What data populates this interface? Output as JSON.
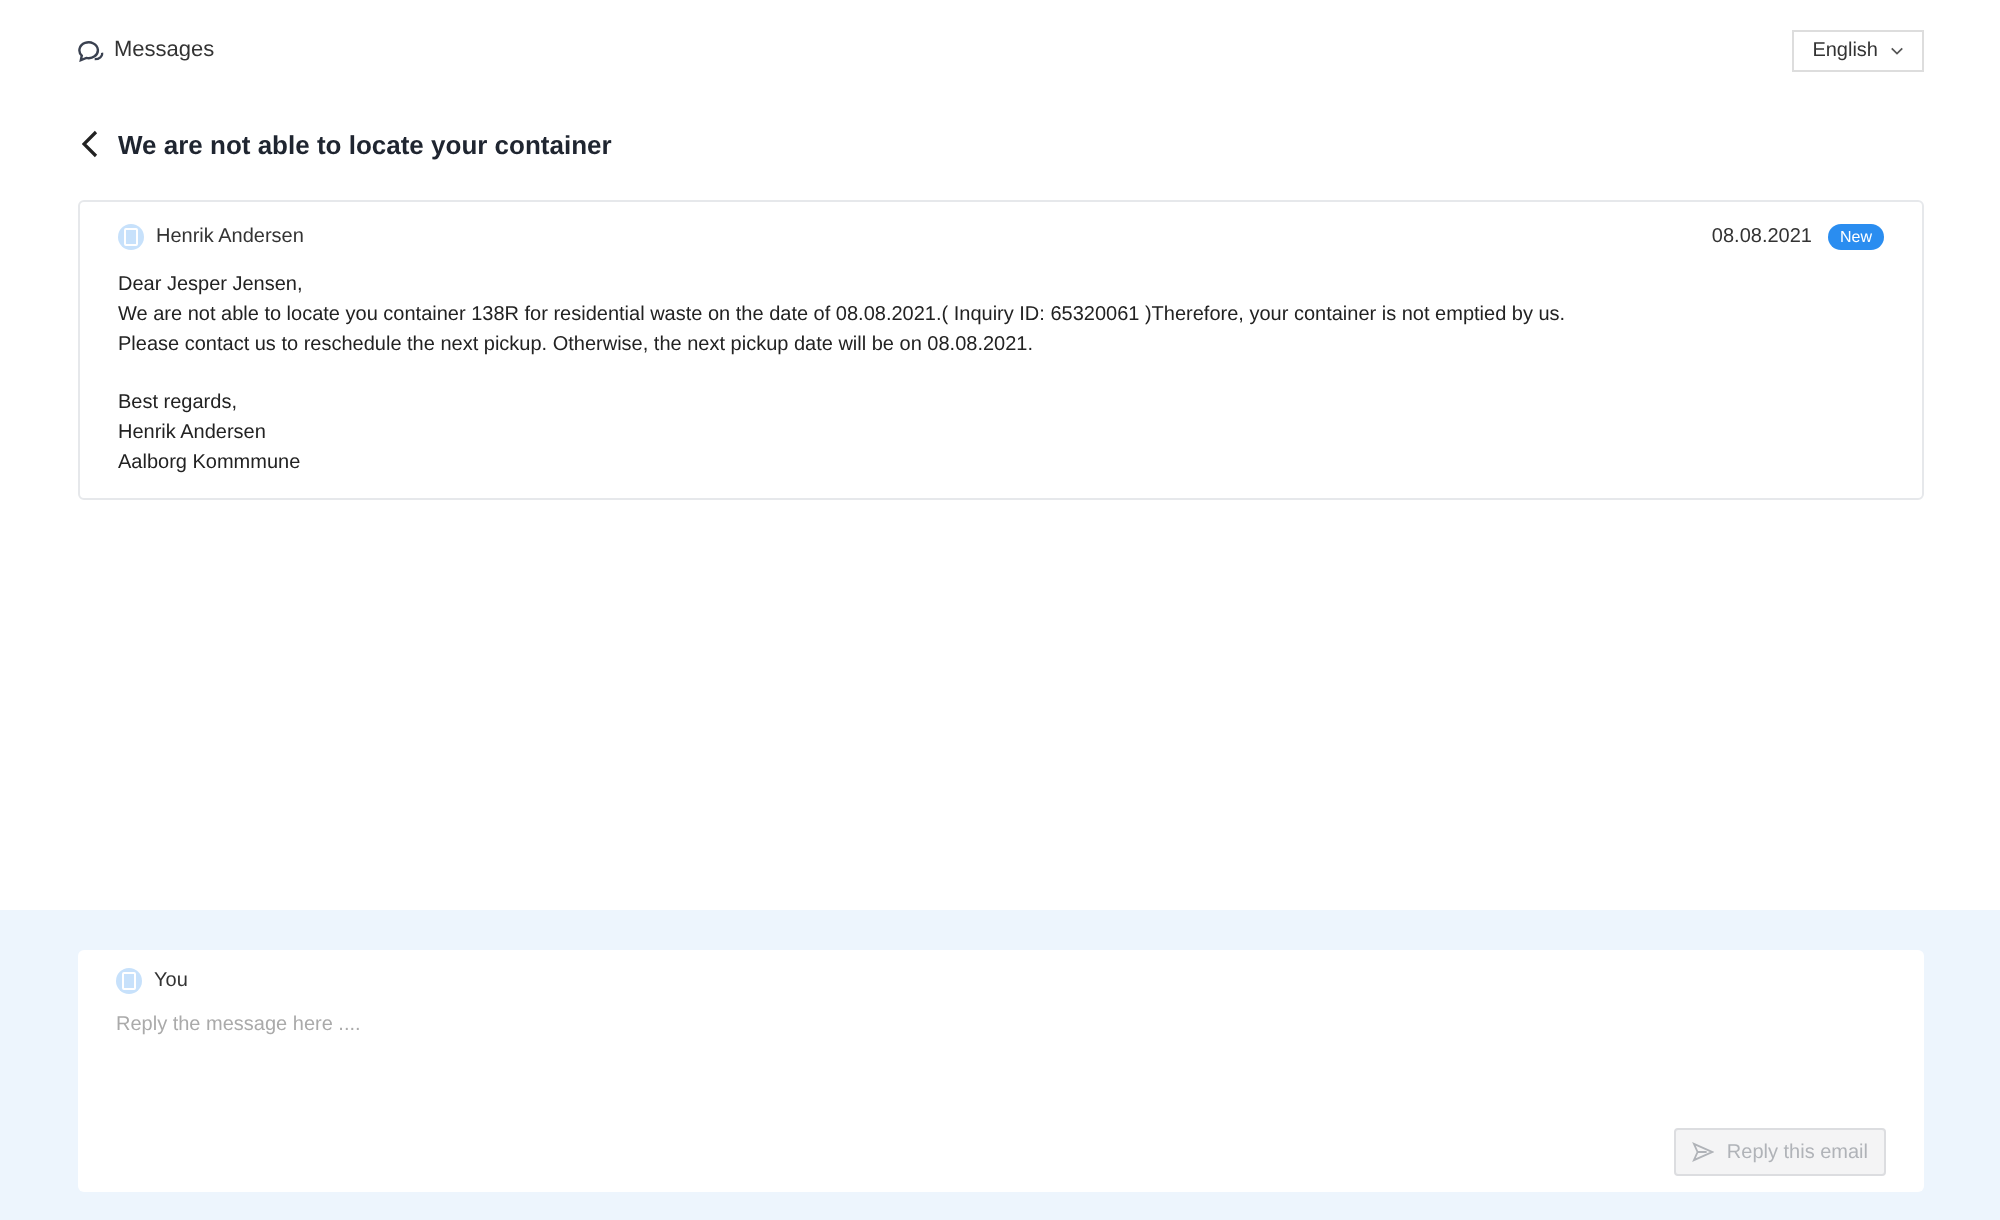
{
  "header": {
    "title": "Messages",
    "language": "English"
  },
  "page_title": "We are not able to locate your container",
  "message": {
    "sender": "Henrik Andersen",
    "date": "08.08.2021",
    "badge": "New",
    "paragraphs": [
      [
        "Dear Jesper Jensen,",
        "We are not able to locate you container 138R for residential waste on the date of 08.08.2021.( Inquiry ID: 65320061 )Therefore, your container is not emptied by us.",
        "Please contact us to reschedule the next pickup. Otherwise, the next pickup date will be on 08.08.2021."
      ],
      [
        "Best regards,",
        "Henrik Andersen",
        "Aalborg Kommmune"
      ]
    ]
  },
  "reply": {
    "author": "You",
    "placeholder": "Reply the message here ....",
    "button": {
      "label": "Reply this email",
      "disabled": true
    }
  }
}
